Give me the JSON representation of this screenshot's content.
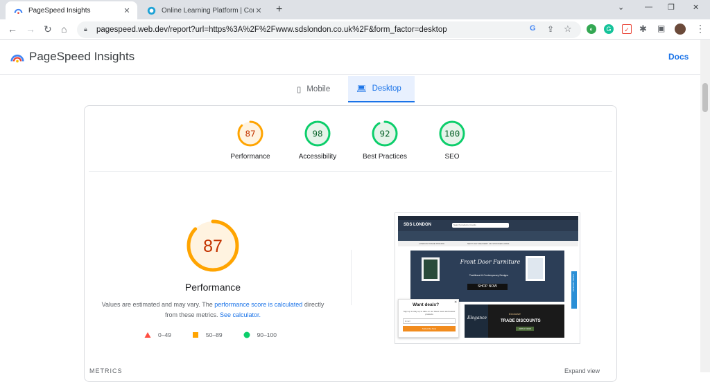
{
  "browser": {
    "tabs": [
      {
        "title": "PageSpeed Insights",
        "active": true
      },
      {
        "title": "Online Learning Platform | Corpo",
        "active": false
      }
    ],
    "url": "pagespeed.web.dev/report?url=https%3A%2F%2Fwww.sdslondon.co.uk%2F&form_factor=desktop"
  },
  "header": {
    "title": "PageSpeed Insights",
    "docs_label": "Docs"
  },
  "device_tabs": {
    "mobile": "Mobile",
    "desktop": "Desktop"
  },
  "scores": [
    {
      "label": "Performance",
      "value": "87",
      "color": "#ffa400",
      "fill": "#fff3e0",
      "text": "#c33300"
    },
    {
      "label": "Accessibility",
      "value": "98",
      "color": "#0cce6b",
      "fill": "#e6f4ea",
      "text": "#0d652d"
    },
    {
      "label": "Best Practices",
      "value": "92",
      "color": "#0cce6b",
      "fill": "#e6f4ea",
      "text": "#0d652d"
    },
    {
      "label": "SEO",
      "value": "100",
      "color": "#0cce6b",
      "fill": "#e6f4ea",
      "text": "#0d652d"
    }
  ],
  "performance": {
    "score": "87",
    "label": "Performance",
    "desc_pre": "Values are estimated and may vary. The ",
    "desc_link1": "performance score is calculated",
    "desc_mid": " directly from these metrics. ",
    "desc_link2": "See calculator."
  },
  "legend": [
    {
      "range": "0–49",
      "color": "#ff4e42",
      "shape": "triangle"
    },
    {
      "range": "50–89",
      "color": "#ffa400",
      "shape": "square"
    },
    {
      "range": "90–100",
      "color": "#0cce6b",
      "shape": "circle"
    }
  ],
  "screenshot": {
    "logo": "SDS LONDON",
    "search_placeholder": "Search products, brands",
    "strip_left": "LONDON TRADE PRICING",
    "strip_mid": "NEXT DAY DELIVERY ON STOCKED LINES",
    "hero_title": "Front Door Furniture",
    "hero_subtitle": "Traditional & Contemporary Designs",
    "hero_button": "SHOP NOW",
    "tile1_text": "Elegance",
    "tile2_top": "Exclusive",
    "tile2_title": "TRADE DISCOUNTS",
    "tile2_button": "APPLY NOW",
    "popup_title": "Want deals?",
    "popup_text": "Sign up to stay up to date on our latest news and lowest products",
    "popup_email": "Email",
    "popup_button": "Subscribe Now",
    "side_tab": "TRADE ACCOUNT"
  },
  "footer": {
    "metrics": "METRICS",
    "expand": "Expand view"
  }
}
